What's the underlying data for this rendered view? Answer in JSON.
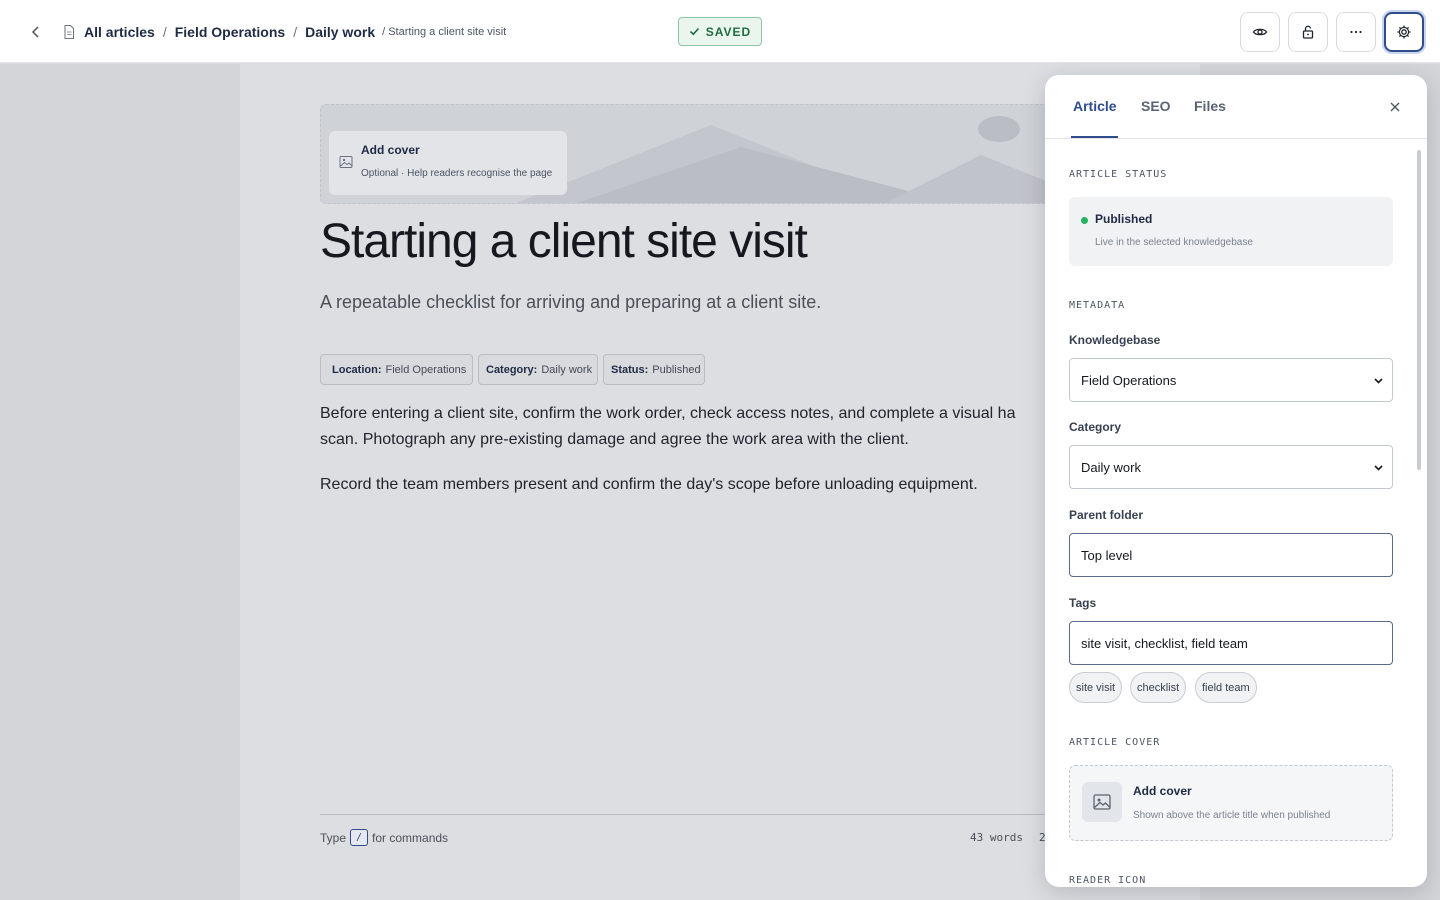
{
  "breadcrumb": {
    "items": [
      "All articles",
      "Field Operations",
      "Daily work"
    ],
    "separator": "/",
    "current": "/ Starting a client site visit"
  },
  "saved_badge": "SAVED",
  "toolbar": {
    "buttons": [
      "eye-icon",
      "unlock-icon",
      "more-icon",
      "gear-icon"
    ]
  },
  "cover_banner": {
    "title": "Add cover",
    "subtitle": "Optional · Help readers recognise the page"
  },
  "article": {
    "title": "Starting a client site visit",
    "subtitle": "A repeatable checklist for arriving and preparing at a client site.",
    "meta": [
      {
        "label": "Location:",
        "value": "Field Operations"
      },
      {
        "label": "Category:",
        "value": "Daily work"
      },
      {
        "label": "Status:",
        "value": "Published"
      }
    ],
    "paragraphs": [
      "Before entering a client site, confirm the work order, check access notes, and complete a visual ha",
      "scan. Photograph any pre-existing damage and agree the work area with the client.",
      "Record the team members present and confirm the day's scope before unloading equipment."
    ]
  },
  "editor_footer": {
    "hint_before": "Type",
    "hint_key": "/",
    "hint_after": "for commands",
    "word_count": "43 words",
    "word_count_extra": "2"
  },
  "panel": {
    "tabs": [
      "Article",
      "SEO",
      "Files"
    ],
    "active_tab": "Article",
    "status_section": "ARTICLE STATUS",
    "status": {
      "title": "Published",
      "description": "Live in the selected knowledgebase"
    },
    "metadata_section": "METADATA",
    "knowledgebase": {
      "label": "Knowledgebase",
      "value": "Field Operations"
    },
    "category": {
      "label": "Category",
      "value": "Daily work"
    },
    "parent_folder": {
      "label": "Parent folder",
      "value": "Top level"
    },
    "tags": {
      "label": "Tags",
      "value": "site visit, checklist, field team",
      "chips": [
        "site visit",
        "checklist",
        "field team"
      ]
    },
    "cover_section": "ARTICLE COVER",
    "cover": {
      "title": "Add cover",
      "description": "Shown above the article title when published"
    },
    "reader_icon_section": "READER ICON"
  },
  "colors": {
    "accent": "#2f4c8c",
    "status_green": "#22b35e",
    "saved_green": "#1f6b43"
  }
}
